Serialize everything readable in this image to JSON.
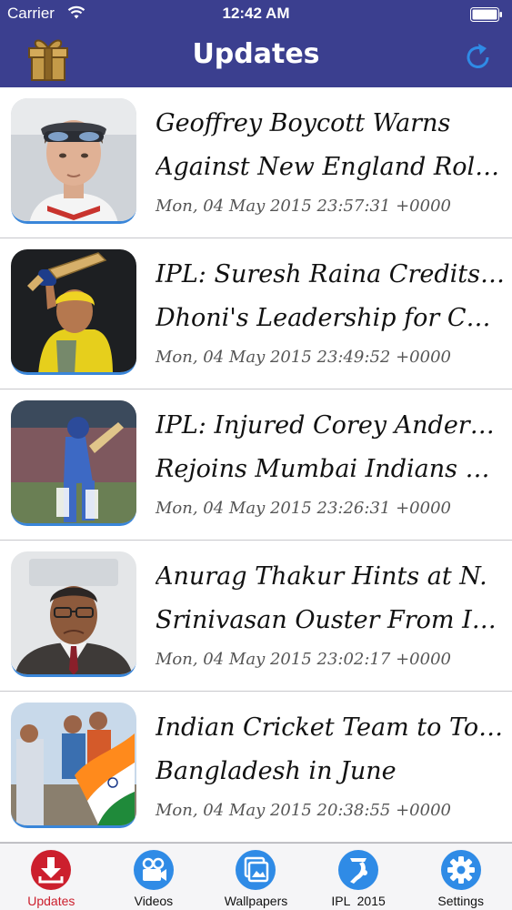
{
  "status_bar": {
    "carrier": "Carrier",
    "time": "12:42 AM",
    "wifi_icon": "wifi-icon",
    "battery_icon": "battery-icon"
  },
  "nav": {
    "title": "Updates",
    "left_icon": "gift-icon",
    "right_icon": "refresh-icon",
    "bar_color": "#3b3f8f",
    "refresh_color": "#2f8be6"
  },
  "articles": [
    {
      "line1": "Geoffrey Boycott Warns",
      "line2": "Against New England Role f...",
      "date": "Mon, 04 May 2015 23:57:31 +0000",
      "thumb": "portrait-cricketer-with-sunglasses"
    },
    {
      "line1": "IPL: Suresh Raina Credits MS",
      "line2": "Dhoni's Leadership for Chen...",
      "date": "Mon, 04 May 2015 23:49:52 +0000",
      "thumb": "batsman-in-yellow-raising-bat"
    },
    {
      "line1": "IPL: Injured Corey Anderson",
      "line2": "Rejoins Mumbai Indians Squ...",
      "date": "Mon, 04 May 2015 23:26:31 +0000",
      "thumb": "batsman-in-blue-playing-shot"
    },
    {
      "line1": "Anurag Thakur Hints at N.",
      "line2": "Srinivasan Ouster From ICC",
      "date": "Mon, 04 May 2015 23:02:17 +0000",
      "thumb": "official-with-glasses-and-suit"
    },
    {
      "line1": "Indian Cricket Team to Tour",
      "line2": "Bangladesh in June",
      "date": "Mon, 04 May 2015 20:38:55 +0000",
      "thumb": "team-with-indian-flag"
    }
  ],
  "tabs": [
    {
      "label": "Updates",
      "icon": "download-icon",
      "active": true,
      "color": "#cc1f2d"
    },
    {
      "label": "Videos",
      "icon": "video-camera-icon",
      "active": false,
      "color": "#2f8be6"
    },
    {
      "label": "Wallpapers",
      "icon": "pictures-icon",
      "active": false,
      "color": "#2f8be6"
    },
    {
      "label": "IPL  2015",
      "icon": "ipl-logo-icon",
      "active": false,
      "color": "#2f8be6"
    },
    {
      "label": "Settings",
      "icon": "gear-icon",
      "active": false,
      "color": "#2f8be6"
    }
  ]
}
